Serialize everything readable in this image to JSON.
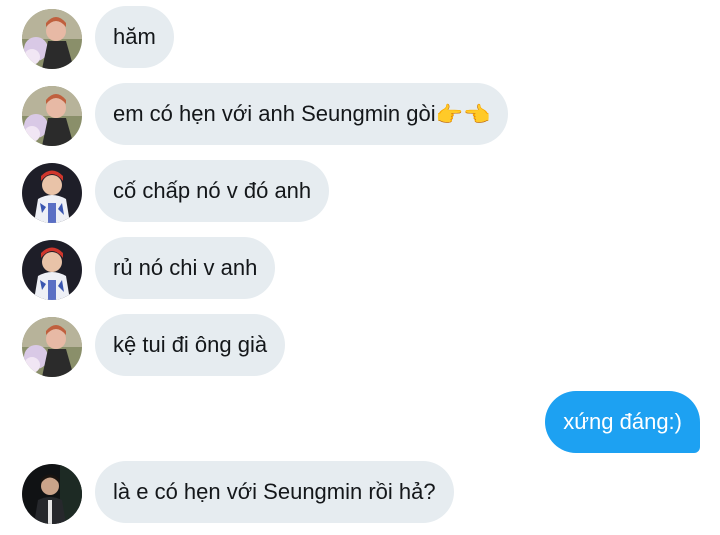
{
  "messages": [
    {
      "text": "hăm",
      "sender": "user-a",
      "emoji": ""
    },
    {
      "text": "em có hẹn với anh Seungmin gòi",
      "sender": "user-a",
      "emoji": "👉👈"
    },
    {
      "text": "cố chấp nó v đó anh",
      "sender": "user-b",
      "emoji": ""
    },
    {
      "text": "rủ nó chi v anh",
      "sender": "user-b",
      "emoji": ""
    },
    {
      "text": "kệ tui đi ông già",
      "sender": "user-a",
      "emoji": ""
    },
    {
      "text": "xứng đáng:)",
      "sender": "me",
      "emoji": ""
    },
    {
      "text": "là e có hẹn với Seungmin rồi hả?",
      "sender": "user-c",
      "emoji": ""
    }
  ],
  "colors": {
    "received_bubble": "#e6ecf0",
    "sent_bubble": "#1da1f2",
    "received_text": "#14171a",
    "sent_text": "#ffffff"
  }
}
